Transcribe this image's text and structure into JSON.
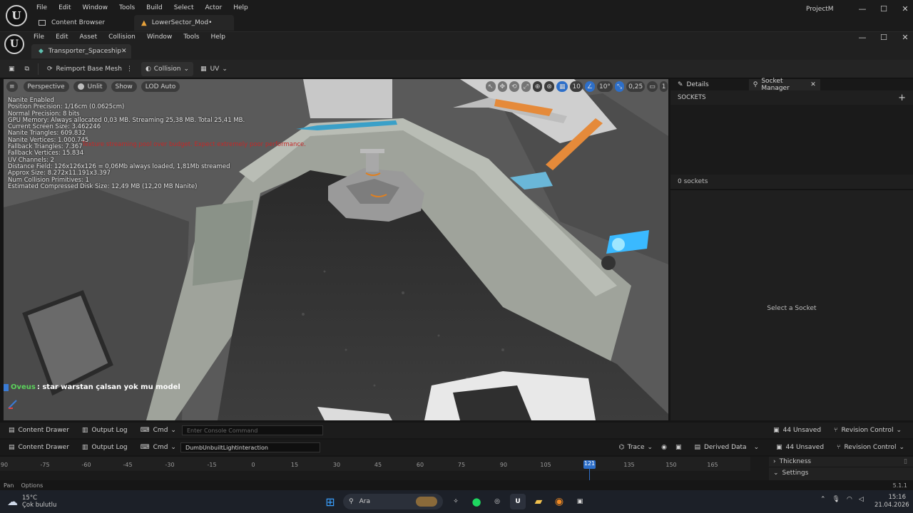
{
  "outer": {
    "menu": [
      "File",
      "Edit",
      "Window",
      "Tools",
      "Build",
      "Select",
      "Actor",
      "Help"
    ],
    "tab_content_browser": "Content Browser",
    "tab_level": "LowerSector_Mod•",
    "project": "ProjectM"
  },
  "inner": {
    "menu": [
      "File",
      "Edit",
      "Asset",
      "Collision",
      "Window",
      "Tools",
      "Help"
    ],
    "asset_tab": "Transporter_Spaceship"
  },
  "toolbar": {
    "reimport": "Reimport Base Mesh",
    "collision": "Collision",
    "uv": "UV"
  },
  "viewport": {
    "perspective": "Perspective",
    "lit_mode": "Unlit",
    "show": "Show",
    "lod": "LOD Auto",
    "grid_snap": "10",
    "rot_snap": "10°",
    "scale_snap": "0,25",
    "cam_speed": "1",
    "stats": [
      "Nanite Enabled",
      "Position Precision: 1/16cm (0.0625cm)",
      "Normal Precision: 8 bits",
      "GPU Memory: Always allocated 0,03 MB. Streaming 25,38 MB. Total 25,41 MB.",
      "Current Screen Size: 3.462246",
      "Nanite Triangles: 609.832",
      "Nanite Vertices: 1.000.745",
      "Fallback Triangles: 7.367",
      "Fallback Vertices: 15.834",
      "UV Channels: 2",
      "Distance Field: 126x126x126 = 0,06Mb always loaded, 1,81Mb streamed",
      "Approx Size: 8.272x11.191x3.397",
      "Num Collision Primitives: 1",
      "Estimated Compressed Disk Size: 12,49 MB (12,20 MB Nanite)"
    ],
    "warning": "Texture streaming pool over budget. Expect extremely poor performance.",
    "chat_user": "Oveus",
    "chat_message": ": star warstan çalsan yok mu model"
  },
  "panel": {
    "tab_details": "Details",
    "tab_sockets": "Socket Manager",
    "sockets_header": "SOCKETS",
    "socket_count": "0 sockets",
    "select_hint": "Select a Socket"
  },
  "bottom1": {
    "content_drawer": "Content Drawer",
    "output_log": "Output Log",
    "cmd": "Cmd",
    "console_placeholder": "Enter Console Command",
    "unsaved": "44 Unsaved",
    "revision": "Revision Control"
  },
  "bottom2": {
    "content_drawer": "Content Drawer",
    "output_log": "Output Log",
    "cmd": "Cmd",
    "console_value": "DumbUnbuiltLightinteraction",
    "trace": "Trace",
    "derived": "Derived Data",
    "unsaved": "44 Unsaved",
    "revision": "Revision Control"
  },
  "timeline": {
    "ticks": [
      "90",
      "-75",
      "-60",
      "-45",
      "-30",
      "-15",
      "0",
      "15",
      "30",
      "45",
      "60",
      "75",
      "90",
      "105",
      "121",
      "135",
      "150",
      "165"
    ],
    "current_frame": "121",
    "thickness": "Thickness",
    "settings": "Settings",
    "pan": "Pan",
    "options": "Options",
    "version": "5.1.1"
  },
  "taskbar": {
    "temp": "15°C",
    "weather": "Çok bulutlu",
    "search": "Ara",
    "time": "15:16",
    "date": "21.04.2026"
  }
}
